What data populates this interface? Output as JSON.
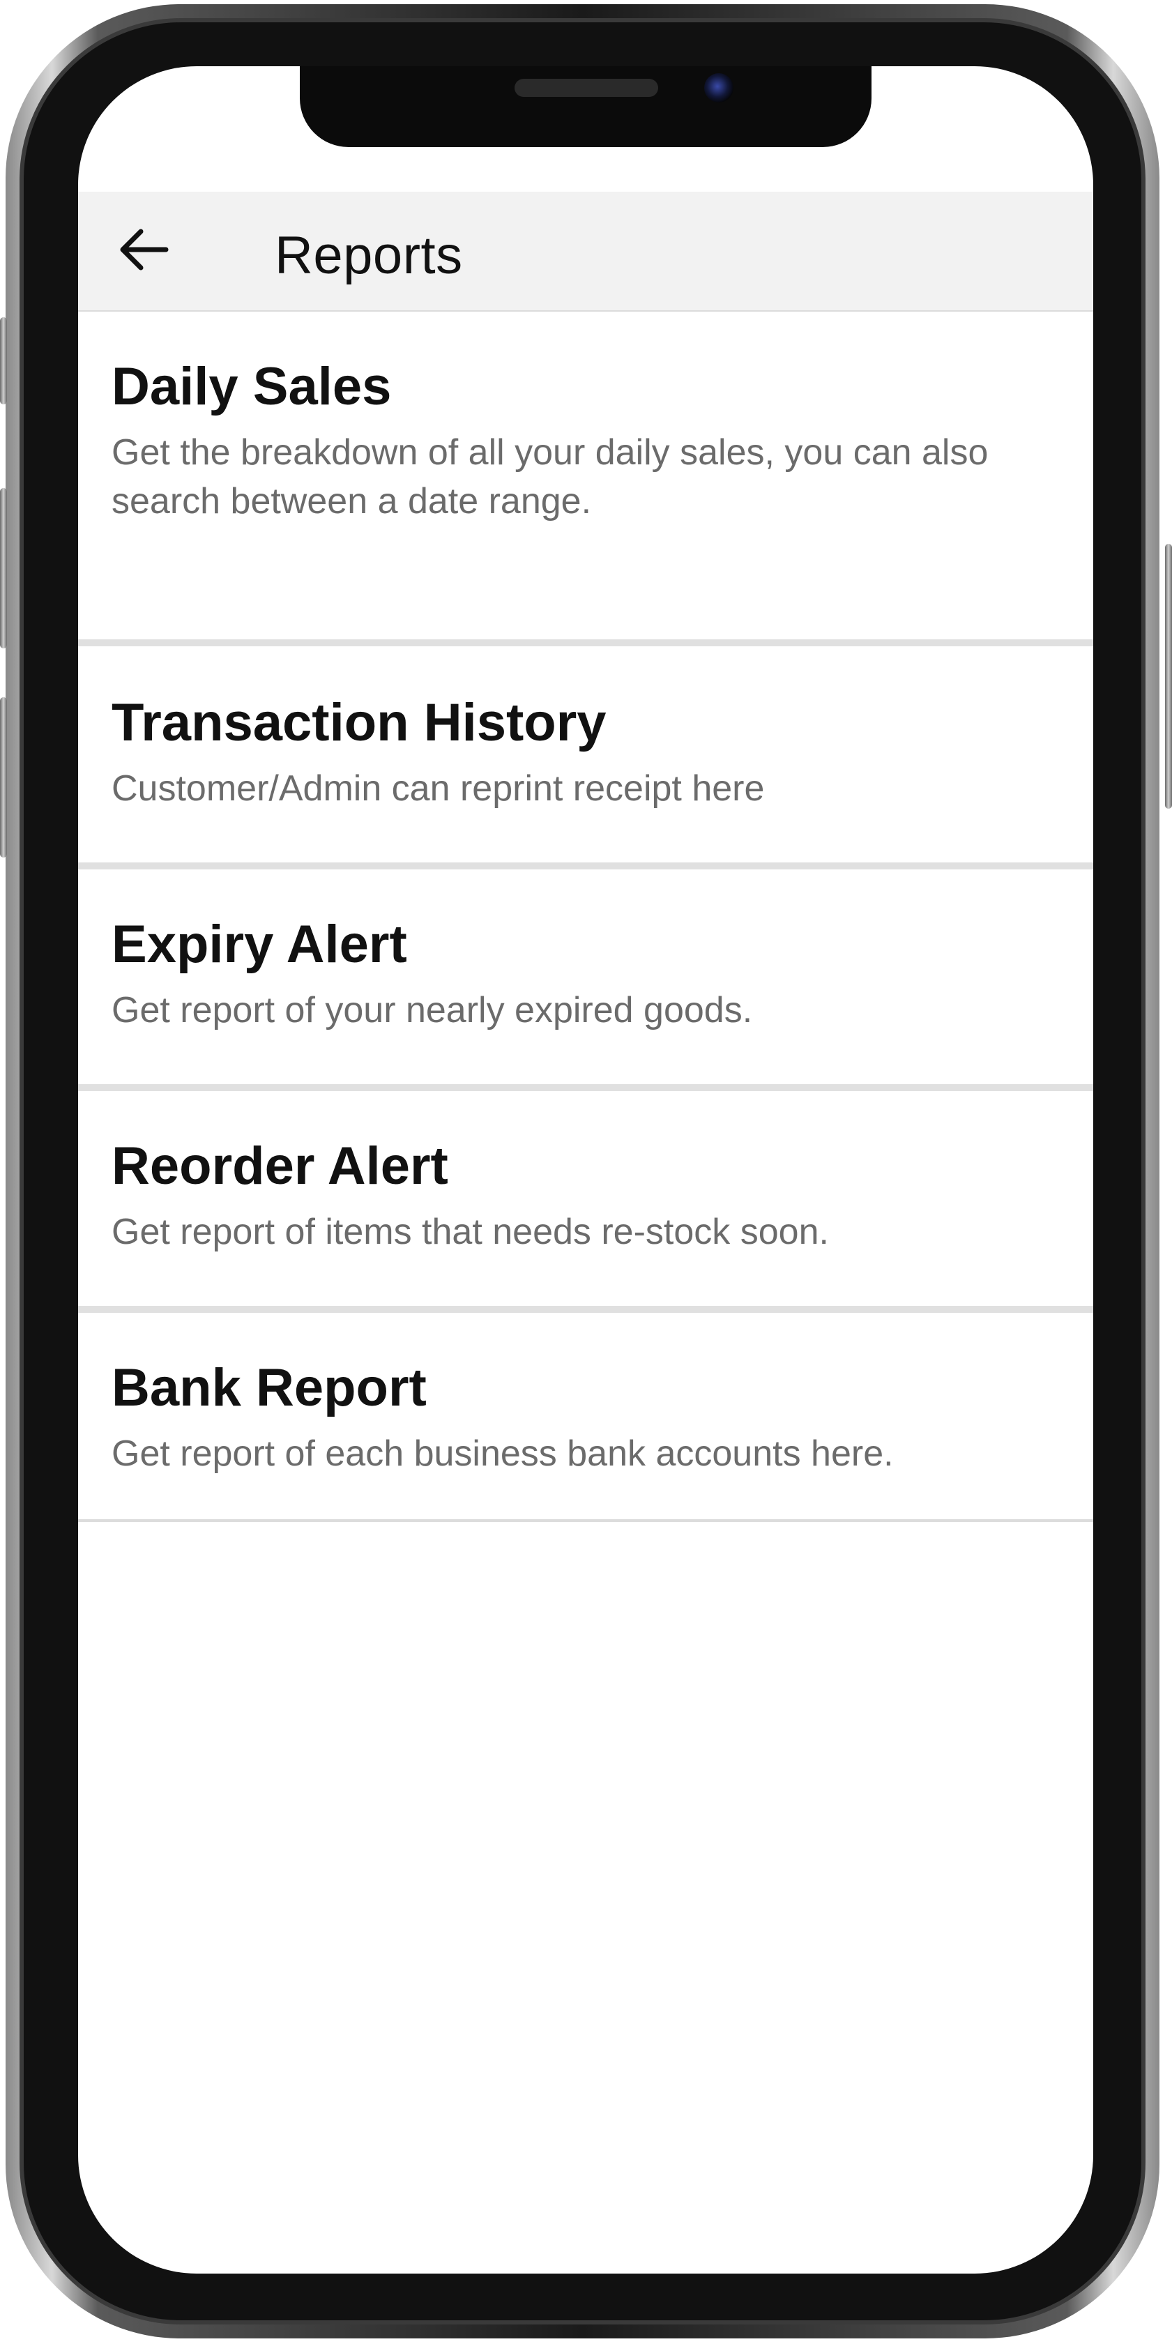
{
  "header": {
    "title": "Reports",
    "back_icon": "arrow-left-icon"
  },
  "reports": [
    {
      "title": "Daily Sales",
      "description": "Get the breakdown of all your daily sales, you can also search between a date range."
    },
    {
      "title": "Transaction History",
      "description": "Customer/Admin can reprint receipt here"
    },
    {
      "title": "Expiry Alert",
      "description": "Get report of your nearly expired goods."
    },
    {
      "title": "Reorder Alert",
      "description": "Get report of items that needs re-stock soon."
    },
    {
      "title": "Bank Report",
      "description": "Get report of each business bank accounts here."
    }
  ],
  "colors": {
    "app_bar_background": "#f2f2f2",
    "title_text": "#111111",
    "description_text": "#6b6b6b",
    "divider": "#e0e0e0"
  }
}
